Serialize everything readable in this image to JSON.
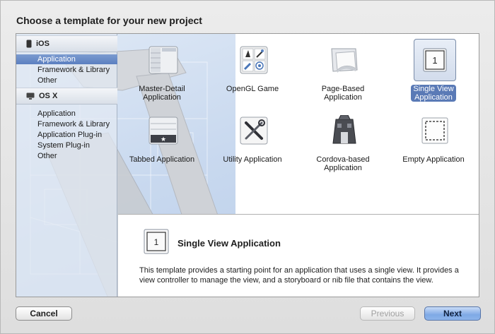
{
  "dialog": {
    "title": "Choose a template for your new project"
  },
  "sidebar": {
    "groups": [
      {
        "name": "iOS",
        "icon": "iphone-icon",
        "items": [
          {
            "label": "Application",
            "selected": true
          },
          {
            "label": "Framework & Library",
            "selected": false
          },
          {
            "label": "Other",
            "selected": false
          }
        ]
      },
      {
        "name": "OS X",
        "icon": "mac-icon",
        "items": [
          {
            "label": "Application",
            "selected": false
          },
          {
            "label": "Framework & Library",
            "selected": false
          },
          {
            "label": "Application Plug-in",
            "selected": false
          },
          {
            "label": "System Plug-in",
            "selected": false
          },
          {
            "label": "Other",
            "selected": false
          }
        ]
      }
    ]
  },
  "templates": [
    {
      "line1": "Master-Detail",
      "line2": "Application",
      "icon": "master-detail-icon",
      "selected": false
    },
    {
      "line1": "OpenGL Game",
      "line2": "",
      "icon": "opengl-game-icon",
      "selected": false
    },
    {
      "line1": "Page-Based",
      "line2": "Application",
      "icon": "page-based-icon",
      "selected": false
    },
    {
      "line1": "Single View",
      "line2": "Application",
      "icon": "single-view-icon",
      "selected": true
    },
    {
      "line1": "Tabbed Application",
      "line2": "",
      "icon": "tabbed-icon",
      "selected": false
    },
    {
      "line1": "Utility Application",
      "line2": "",
      "icon": "utility-icon",
      "selected": false
    },
    {
      "line1": "Cordova-based",
      "line2": "Application",
      "icon": "cordova-icon",
      "selected": false
    },
    {
      "line1": "Empty Application",
      "line2": "",
      "icon": "empty-app-icon",
      "selected": false
    }
  ],
  "detail": {
    "icon_glyph": "1",
    "title": "Single View Application",
    "description": "This template provides a starting point for an application that uses a single view. It provides a view controller to manage the view, and a storyboard or nib file that contains the view."
  },
  "buttons": {
    "cancel": "Cancel",
    "previous": "Previous",
    "next": "Next"
  },
  "colors": {
    "selection": "#5b7fc0",
    "primary_button": "#7fa9e6"
  }
}
